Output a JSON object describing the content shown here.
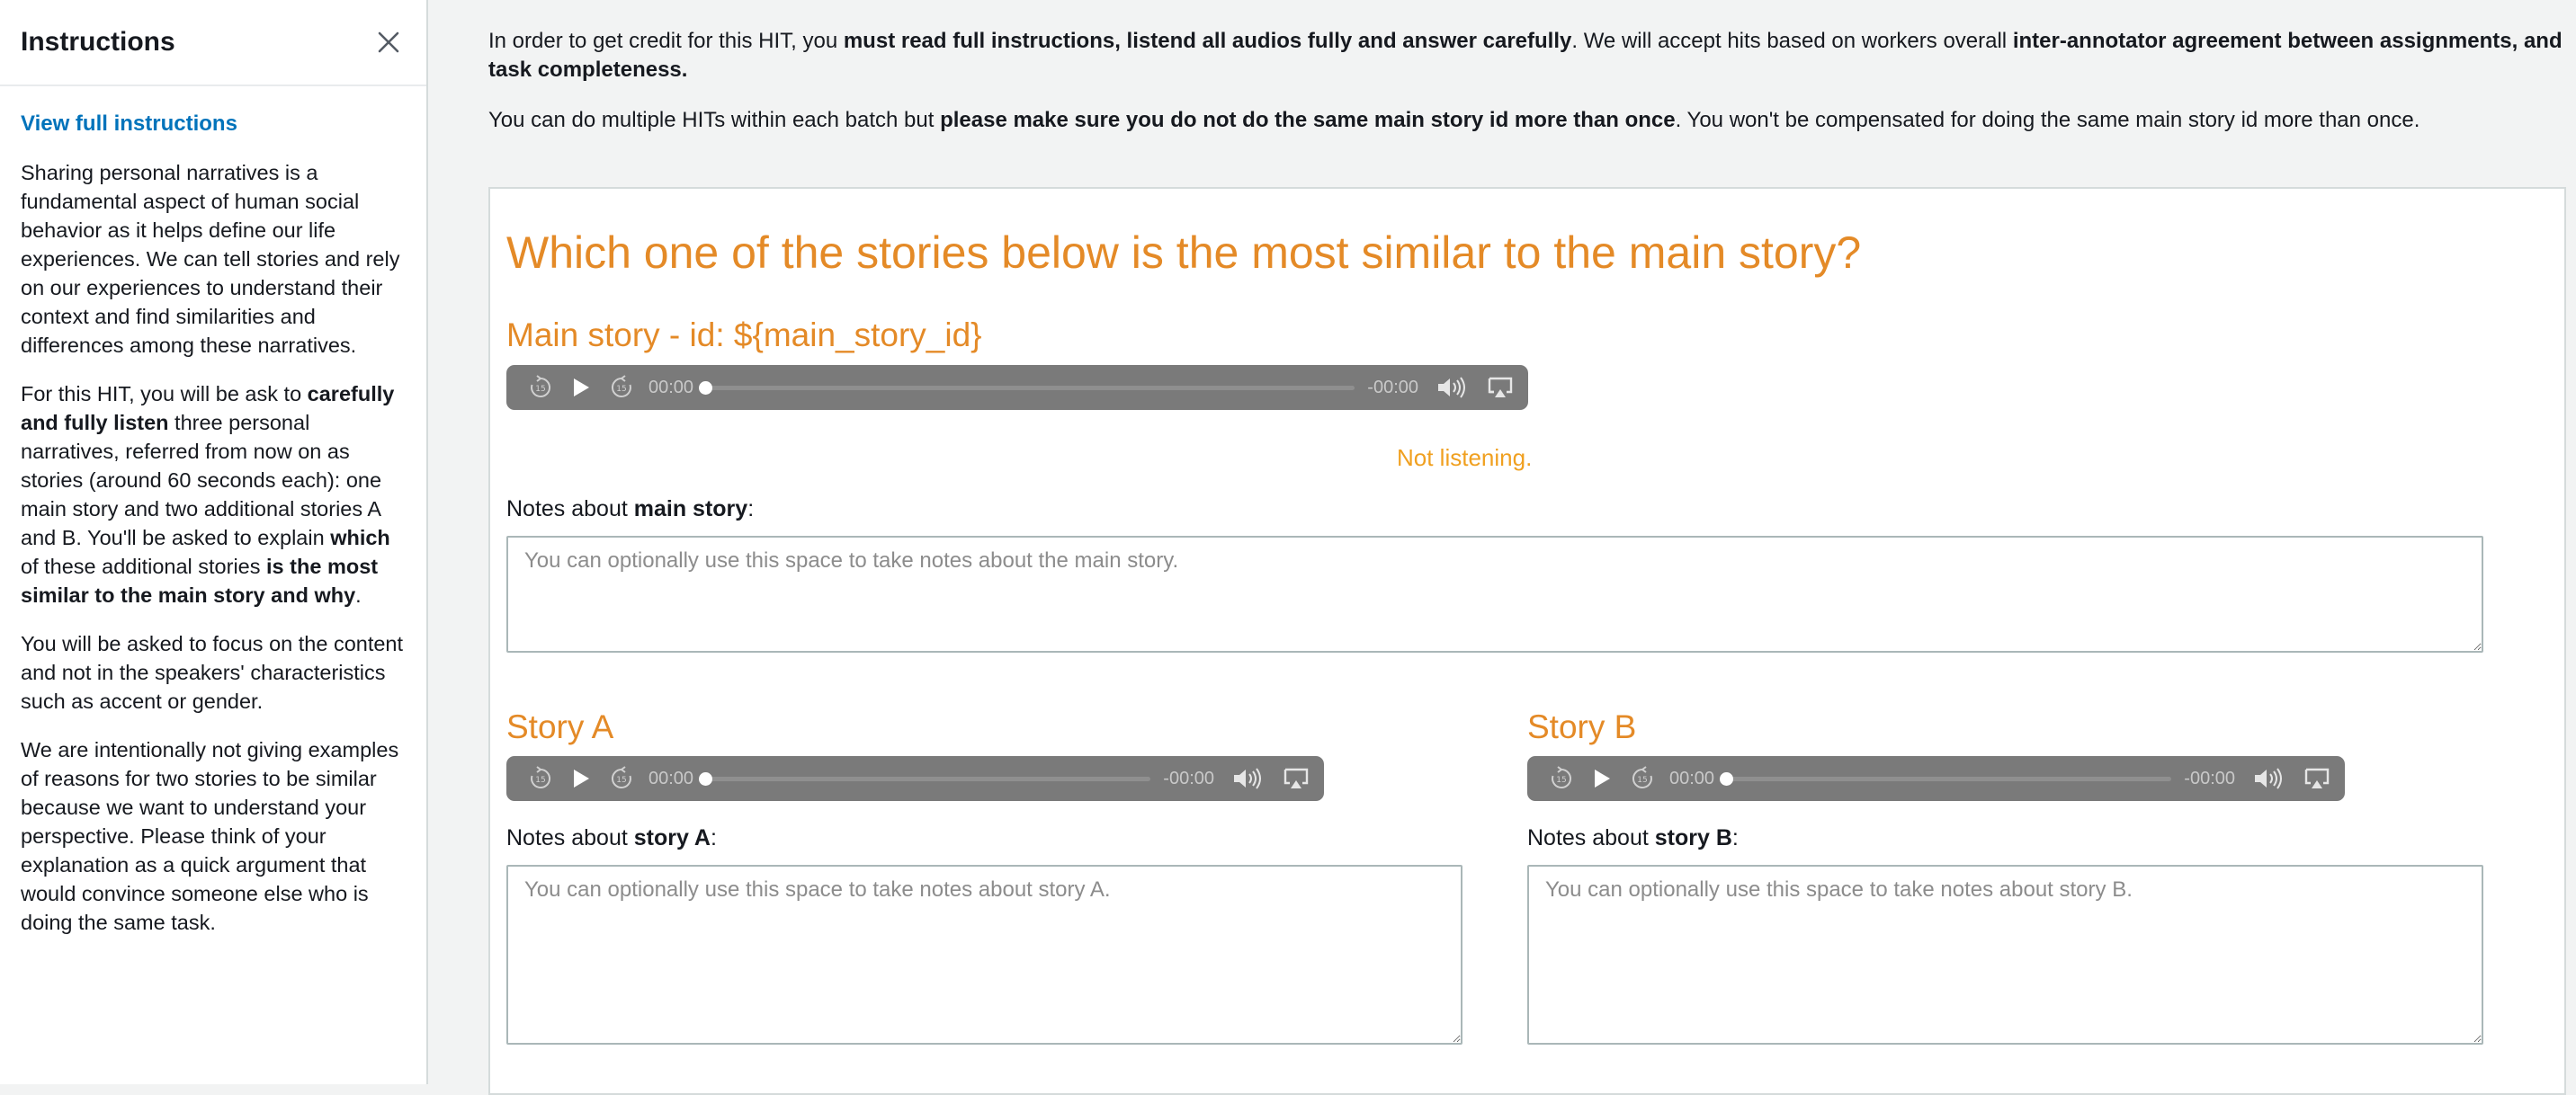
{
  "sidebar": {
    "title": "Instructions",
    "view_full_link": "View full instructions",
    "p1": "Sharing personal narratives is a fundamental aspect of human social behavior as it helps define our life experiences. We can tell stories and rely on our experiences to understand their context and find similarities and differences among these narratives.",
    "p2_a": "For this HIT, you will be ask to ",
    "p2_b": "carefully and fully listen",
    "p2_c": " three personal narratives, referred from now on as stories (around 60 seconds each): one main story and two additional stories A and B. You'll be asked to explain ",
    "p2_d": "which",
    "p2_e": " of these additional stories ",
    "p2_f": "is the most similar to the main story and why",
    "p2_g": ".",
    "p3": "You will be asked to focus on the content and not in the speakers' characteristics such as accent or gender.",
    "p4": "We are intentionally not giving examples of reasons for two stories to be similar because we want to understand your perspective. Please think of your explanation as a quick argument that would convince someone else who is doing the same task."
  },
  "intro": {
    "p1_a": "In order to get credit for this HIT, you ",
    "p1_b": "must read full instructions, listend all audios fully and answer carefully",
    "p1_c": ". We will accept hits based on workers overall ",
    "p1_d": "inter-annotator agreement between assignments, and task completeness.",
    "p2_a": "You can do multiple HITs within each batch but ",
    "p2_b": "please make sure you do not do the same main story id more than once",
    "p2_c": ". You won't be compensated for doing the same main story id more than once."
  },
  "form": {
    "question": "Which one of the stories below is the most similar to the main story?",
    "main_heading": "Main story - id: ${main_story_id}",
    "status": "Not listening.",
    "main_notes_prefix": "Notes about ",
    "main_notes_bold": "main story",
    "main_notes_suffix": ":",
    "main_placeholder": "You can optionally use this space to take notes about the main story.",
    "story_a_heading": "Story A",
    "story_a_notes_prefix": "Notes about ",
    "story_a_notes_bold": "story A",
    "story_a_notes_suffix": ":",
    "story_a_placeholder": "You can optionally use this space to take notes about story A.",
    "story_b_heading": "Story B",
    "story_b_notes_prefix": "Notes about ",
    "story_b_notes_bold": "story B",
    "story_b_notes_suffix": ":",
    "story_b_placeholder": "You can optionally use this space to take notes about story B."
  },
  "players": {
    "main": {
      "current_time": "00:00",
      "remaining_time": "-00:00",
      "progress": 0
    },
    "story_a": {
      "current_time": "00:00",
      "remaining_time": "-00:00",
      "progress": 0
    },
    "story_b": {
      "current_time": "00:00",
      "remaining_time": "-00:00",
      "progress": 0
    }
  },
  "player_icons": [
    "rewind-15-icon",
    "play-icon",
    "forward-15-icon",
    "volume-icon",
    "airplay-icon"
  ],
  "colors": {
    "accent": "#e48a27",
    "status": "#f0a020",
    "link": "#0073bb",
    "player_bg": "#7a7a7a"
  }
}
